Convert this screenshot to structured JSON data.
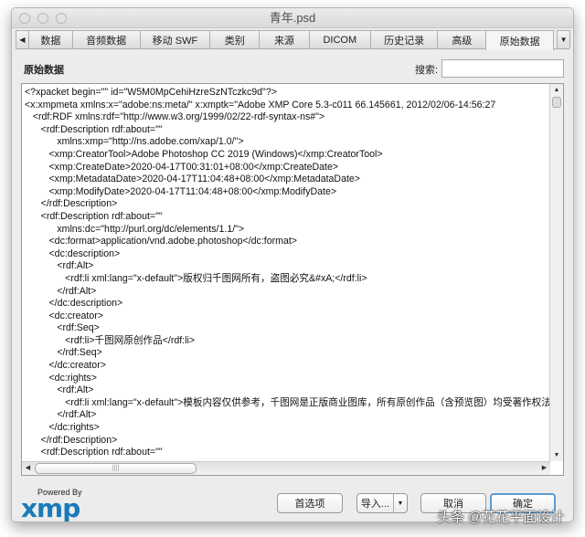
{
  "window": {
    "title": "青年.psd"
  },
  "tabs": [
    "数据",
    "音频数据",
    "移动 SWF",
    "类别",
    "来源",
    "DICOM",
    "历史记录",
    "高级",
    "原始数据"
  ],
  "active_tab": "原始数据",
  "section_title": "原始数据",
  "search": {
    "label": "搜索:",
    "value": ""
  },
  "lines": [
    "<?xpacket begin=\"\" id=\"W5M0MpCehiHzreSzNTczkc9d\"?>",
    "<x:xmpmeta xmlns:x=\"adobe:ns:meta/\" x:xmptk=\"Adobe XMP Core 5.3-c011 66.145661, 2012/02/06-14:56:27",
    "   <rdf:RDF xmlns:rdf=\"http://www.w3.org/1999/02/22-rdf-syntax-ns#\">",
    "      <rdf:Description rdf:about=\"\"",
    "            xmlns:xmp=\"http://ns.adobe.com/xap/1.0/\">",
    "         <xmp:CreatorTool>Adobe Photoshop CC 2019 (Windows)</xmp:CreatorTool>",
    "         <xmp:CreateDate>2020-04-17T00:31:01+08:00</xmp:CreateDate>",
    "         <xmp:MetadataDate>2020-04-17T11:04:48+08:00</xmp:MetadataDate>",
    "         <xmp:ModifyDate>2020-04-17T11:04:48+08:00</xmp:ModifyDate>",
    "      </rdf:Description>",
    "      <rdf:Description rdf:about=\"\"",
    "            xmlns:dc=\"http://purl.org/dc/elements/1.1/\">",
    "         <dc:format>application/vnd.adobe.photoshop</dc:format>",
    "         <dc:description>",
    "            <rdf:Alt>",
    "               <rdf:li xml:lang=\"x-default\">版权归千图网所有，盗图必究&#xA;</rdf:li>",
    "            </rdf:Alt>",
    "         </dc:description>",
    "         <dc:creator>",
    "            <rdf:Seq>",
    "               <rdf:li>千图网原创作品</rdf:li>",
    "            </rdf:Seq>",
    "         </dc:creator>",
    "         <dc:rights>",
    "            <rdf:Alt>",
    "               <rdf:li xml:lang=\"x-default\">模板内容仅供参考，千图网是正版商业图库，所有原创作品（含预览图）均受著作权法保",
    "            </rdf:Alt>",
    "         </dc:rights>",
    "      </rdf:Description>",
    "      <rdf:Description rdf:about=\"\""
  ],
  "footer": {
    "powered_by": "Powered By",
    "logo": "xmp"
  },
  "buttons": {
    "preferences": "首选项",
    "import": "导入...",
    "cancel": "取消",
    "ok": "确定"
  },
  "watermark": "头条 @花花平面设计"
}
